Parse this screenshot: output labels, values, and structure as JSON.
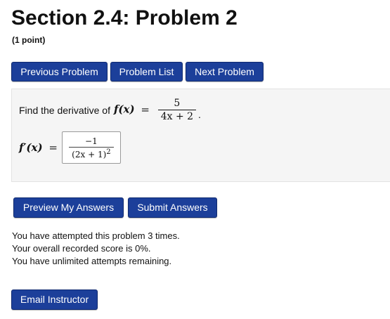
{
  "header": {
    "title": "Section 2.4: Problem 2",
    "points": "(1 point)"
  },
  "nav": {
    "previous": "Previous Problem",
    "list": "Problem List",
    "next": "Next Problem"
  },
  "problem": {
    "statement_prefix": "Find the derivative of",
    "function_name": "f(x)",
    "equals": "=",
    "numerator": "5",
    "denominator": "4x + 2",
    "trailing_period": ".",
    "derivative_label": "f′(x)",
    "answer": {
      "numerator": "−1",
      "denominator": "(2x + 1)",
      "exponent": "2"
    }
  },
  "actions": {
    "preview": "Preview My Answers",
    "submit": "Submit Answers"
  },
  "status": {
    "attempts": "You have attempted this problem 3 times.",
    "score": "Your overall recorded score is 0%.",
    "remaining": "You have unlimited attempts remaining."
  },
  "footer": {
    "email": "Email Instructor"
  },
  "colors": {
    "button_bg": "#1c3f9a",
    "button_text": "#ffffff",
    "problem_bg": "#f5f5f5"
  }
}
